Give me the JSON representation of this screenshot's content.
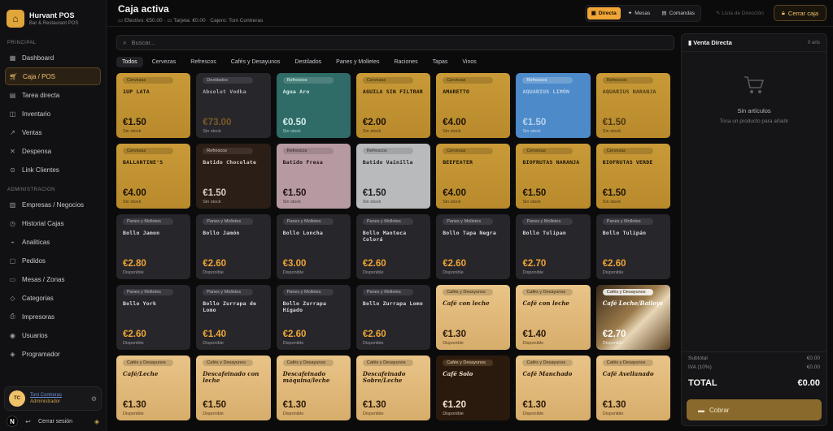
{
  "brand": {
    "title": "Hurvant POS",
    "subtitle": "Bar & Restaurant POS"
  },
  "sidebar": {
    "principal_label": "PRINCIPAL",
    "principal": [
      {
        "label": "Dashboard",
        "icon": "grid-icon"
      },
      {
        "label": "Caja / POS",
        "icon": "cart-icon",
        "active": true
      },
      {
        "label": "Tarea directa",
        "icon": "clipboard-icon"
      },
      {
        "label": "Inventario",
        "icon": "box-icon"
      },
      {
        "label": "Ventas",
        "icon": "chart-icon"
      },
      {
        "label": "Despensa",
        "icon": "utensils-icon"
      },
      {
        "label": "Link Clientes",
        "icon": "link-icon"
      }
    ],
    "admin_label": "ADMINISTRACION",
    "admin": [
      {
        "label": "Empresas / Negocios",
        "icon": "building-icon"
      },
      {
        "label": "Historial Cajas",
        "icon": "history-icon"
      },
      {
        "label": "Analiticas",
        "icon": "analytics-icon"
      },
      {
        "label": "Pedidos",
        "icon": "orders-icon"
      },
      {
        "label": "Mesas / Zonas",
        "icon": "table-icon"
      },
      {
        "label": "Categorias",
        "icon": "tag-icon"
      },
      {
        "label": "Impresoras",
        "icon": "printer-icon"
      },
      {
        "label": "Usuarios",
        "icon": "users-icon"
      },
      {
        "label": "Programador",
        "icon": "shield-icon"
      }
    ],
    "user": {
      "initials": "TC",
      "name": "Toni Contreras",
      "role": "Administrador"
    },
    "logout": "Cerrar sesión"
  },
  "topbar": {
    "title": "Caja activa",
    "efectivo": "Efectivo: €50.00",
    "tarjeta": "Tarjeta: €0.00",
    "cajero": "Cajero: Toni Contreras",
    "modes": [
      "Directa",
      "Mesas",
      "Comandas"
    ],
    "ghost": "Lista de Dirección",
    "close": "Cerrar caja"
  },
  "search": {
    "placeholder": "Buscar..."
  },
  "tabs": [
    "Todos",
    "Cervezas",
    "Refrescos",
    "Cafés y Desayunos",
    "Destilados",
    "Panes y Molletes",
    "Raciones",
    "Tapas",
    "Vinos"
  ],
  "products": [
    {
      "tag": "Cervezas",
      "name": "1UP LATA",
      "price": "€1.50",
      "status": "Sin stock",
      "v": "v-gold"
    },
    {
      "tag": "Destilados",
      "name": "Absolut Vodka",
      "price": "€73.00",
      "status": "Sin stock",
      "v": "v-dark v-dimdark"
    },
    {
      "tag": "Refrescos",
      "name": "Agua Aro",
      "price": "€0.50",
      "status": "Sin stock",
      "v": "v-teal"
    },
    {
      "tag": "Cervezas",
      "name": "AGUILA SIN FILTRAR",
      "price": "€2.00",
      "status": "Sin stock",
      "v": "v-gold"
    },
    {
      "tag": "Cervezas",
      "name": "AMARETTO",
      "price": "€4.00",
      "status": "Sin stock",
      "v": "v-gold"
    },
    {
      "tag": "Refrescos",
      "name": "AQUARIUS LIMÓN",
      "price": "€1.50",
      "status": "Sin stock",
      "v": "v-blue muted"
    },
    {
      "tag": "Refrescos",
      "name": "AQUARIUS NARANJA",
      "price": "€1.50",
      "status": "Sin stock",
      "v": "v-gold muted"
    },
    {
      "tag": "Cervezas",
      "name": "BALLANTINE'S",
      "price": "€4.00",
      "status": "Sin stock",
      "v": "v-gold"
    },
    {
      "tag": "Refrescos",
      "name": "Batido Chocolate",
      "price": "€1.50",
      "status": "Sin stock",
      "v": "v-brown"
    },
    {
      "tag": "Refrescos",
      "name": "Batido Fresa",
      "price": "€1.50",
      "status": "Sin stock",
      "v": "v-pink"
    },
    {
      "tag": "Refrescos",
      "name": "Batido Vainilla",
      "price": "€1.50",
      "status": "Sin stock",
      "v": "v-silver"
    },
    {
      "tag": "Cervezas",
      "name": "BEEFEATER",
      "price": "€4.00",
      "status": "Sin stock",
      "v": "v-gold"
    },
    {
      "tag": "Cervezas",
      "name": "BIOFRUTAS NARANJA",
      "price": "€1.50",
      "status": "Sin stock",
      "v": "v-gold"
    },
    {
      "tag": "Cervezas",
      "name": "BIOFRUTAS VERDE",
      "price": "€1.50",
      "status": "Sin stock",
      "v": "v-gold"
    },
    {
      "tag": "Panes y Molletes",
      "name": "Bollo Jamon",
      "price": "€2.80",
      "status": "Disponible",
      "v": "v-dark"
    },
    {
      "tag": "Panes y Molletes",
      "name": "Bollo Jamón",
      "price": "€2.60",
      "status": "Disponible",
      "v": "v-dark"
    },
    {
      "tag": "Panes y Molletes",
      "name": "Bollo Loncha",
      "price": "€3.00",
      "status": "Disponible",
      "v": "v-dark"
    },
    {
      "tag": "Panes y Molletes",
      "name": "Bollo Manteca Colorá",
      "price": "€2.60",
      "status": "Disponible",
      "v": "v-dark"
    },
    {
      "tag": "Panes y Molletes",
      "name": "Bollo Tapa Negra",
      "price": "€2.60",
      "status": "Disponible",
      "v": "v-dark"
    },
    {
      "tag": "Panes y Molletes",
      "name": "Bollo Tulipan",
      "price": "€2.70",
      "status": "Disponible",
      "v": "v-dark"
    },
    {
      "tag": "Panes y Molletes",
      "name": "Bollo Tulipán",
      "price": "€2.60",
      "status": "Disponible",
      "v": "v-dark"
    },
    {
      "tag": "Panes y Molletes",
      "name": "Bollo York",
      "price": "€2.60",
      "status": "Disponible",
      "v": "v-dark"
    },
    {
      "tag": "Panes y Molletes",
      "name": "Bollo Zurrapa de Lomo",
      "price": "€1.40",
      "status": "Disponible",
      "v": "v-dark"
    },
    {
      "tag": "Panes y Molletes",
      "name": "Bollo Zurrapa Hígado",
      "price": "€2.60",
      "status": "Disponible",
      "v": "v-dark"
    },
    {
      "tag": "Panes y Molletes",
      "name": "Bollo Zurrapa Lomo",
      "price": "€2.60",
      "status": "Disponible",
      "v": "v-dark"
    },
    {
      "tag": "Cafés y Desayunos",
      "name": "Café con leche",
      "price": "€1.30",
      "status": "Disponible",
      "v": "v-latte"
    },
    {
      "tag": "Cafés y Desayunos",
      "name": "Café con leche",
      "price": "€1.40",
      "status": "Disponible",
      "v": "v-latte"
    },
    {
      "tag": "Cafés y Desayunos",
      "name": "Café Leche/Baileys",
      "price": "€2.70",
      "status": "Disponible",
      "v": "v-photo"
    },
    {
      "tag": "Cafés y Desayunos",
      "name": "Café/Leche",
      "price": "€1.30",
      "status": "Disponible",
      "v": "v-latte"
    },
    {
      "tag": "Cafés y Desayunos",
      "name": "Descafeinado con leche",
      "price": "€1.50",
      "status": "Disponible",
      "v": "v-latte"
    },
    {
      "tag": "Cafés y Desayunos",
      "name": "Descafeinado máquina/leche",
      "price": "€1.30",
      "status": "Disponible",
      "v": "v-latte"
    },
    {
      "tag": "Cafés y Desayunos",
      "name": "Descafeinado Sobre/Leche",
      "price": "€1.30",
      "status": "Disponible",
      "v": "v-latte"
    },
    {
      "tag": "Cafés y Desayunos",
      "name": "Café Solo",
      "price": "€1.20",
      "status": "Disponible",
      "v": "v-espresso"
    },
    {
      "tag": "Cafés y Desayunos",
      "name": "Café Manchado",
      "price": "€1.30",
      "status": "Disponible",
      "v": "v-latte"
    },
    {
      "tag": "Cafés y Desayunos",
      "name": "Café Avellanado",
      "price": "€1.30",
      "status": "Disponible",
      "v": "v-latte"
    }
  ],
  "cart": {
    "title": "Venta Directa",
    "count": "0 arts",
    "empty_title": "Sin artículos",
    "empty_sub": "Toca un producto para añadir",
    "subtotal_label": "Subtotal",
    "subtotal": "€0.00",
    "iva_label": "IVA (10%)",
    "iva": "€0.00",
    "total_label": "TOTAL",
    "total": "€0.00",
    "cobrar": "Cobrar"
  }
}
